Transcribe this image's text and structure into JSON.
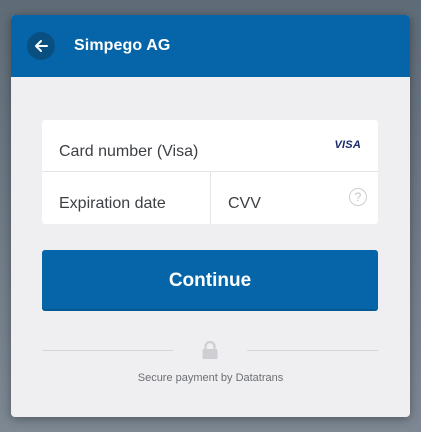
{
  "header": {
    "merchant_name": "Simpego AG"
  },
  "card_form": {
    "card_number_placeholder": "Card number (Visa)",
    "card_brand": "VISA",
    "expiration_placeholder": "Expiration date",
    "cvv_placeholder": "CVV",
    "cvv_help_symbol": "?"
  },
  "actions": {
    "continue_label": "Continue"
  },
  "footer": {
    "secure_text": "Secure payment by Datatrans"
  },
  "colors": {
    "brand": "#0565a8",
    "modal_bg": "#efeff1",
    "visa": "#1a2a6c"
  },
  "icons": {
    "back": "arrow-left-icon",
    "lock": "lock-icon",
    "help": "question-circle-icon"
  }
}
